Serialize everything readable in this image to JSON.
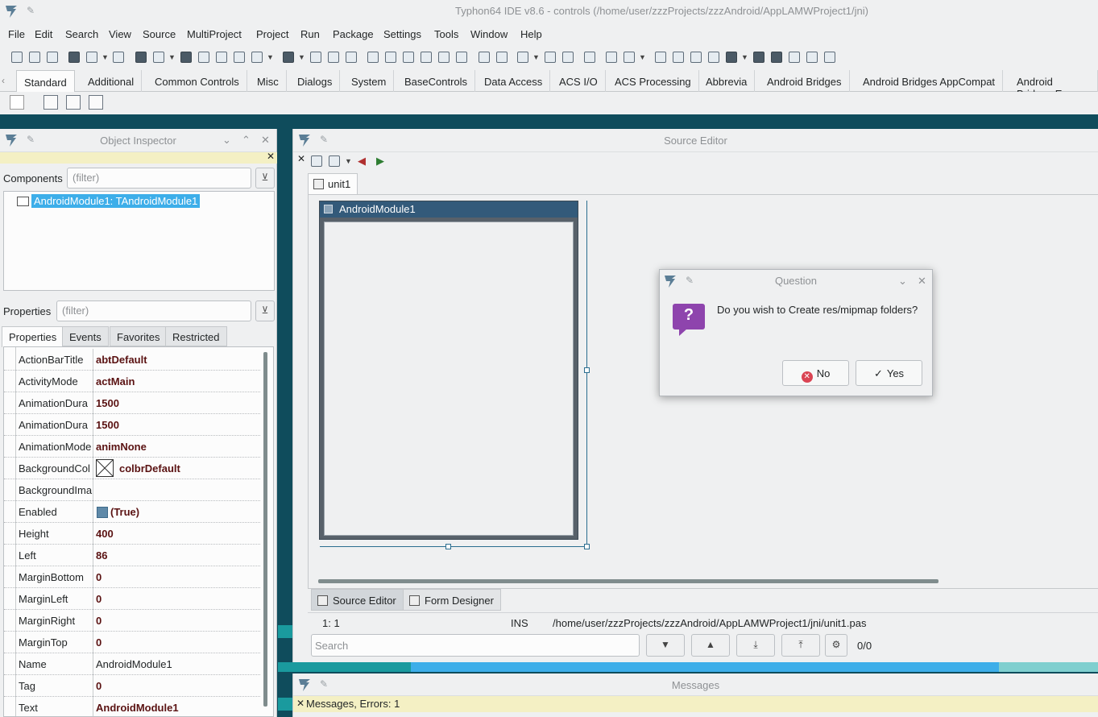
{
  "window": {
    "title": "Typhon64 IDE v8.6 - controls (/home/user/zzzProjects/zzzAndroid/AppLAMWProject1/jni)"
  },
  "menu": [
    "File",
    "Edit",
    "Search",
    "View",
    "Source",
    "MultiProject",
    "Project",
    "Run",
    "Package",
    "Settings",
    "Tools",
    "Window",
    "Help"
  ],
  "palette_tabs": [
    "Standard",
    "Additional",
    "Common Controls",
    "Misc",
    "Dialogs",
    "System",
    "BaseControls",
    "Data Access",
    "ACS I/O",
    "ACS Processing",
    "Abbrevia",
    "Android Bridges",
    "Android Bridges AppCompat",
    "Android Bridges E"
  ],
  "palette_active": "Standard",
  "object_inspector": {
    "title": "Object Inspector",
    "components_label": "Components",
    "components_filter_placeholder": "(filter)",
    "tree_node": "AndroidModule1: TAndroidModule1",
    "properties_label": "Properties",
    "properties_filter_placeholder": "(filter)",
    "tabs": [
      "Properties",
      "Events",
      "Favorites",
      "Restricted"
    ],
    "rows": [
      {
        "name": "ActionBarTitle",
        "value": "abtDefault"
      },
      {
        "name": "ActivityMode",
        "value": "actMain"
      },
      {
        "name": "AnimationDura",
        "value": "1500"
      },
      {
        "name": "AnimationDura",
        "value": "1500"
      },
      {
        "name": "AnimationMode",
        "value": "animNone"
      },
      {
        "name": "BackgroundCol",
        "value": "colbrDefault"
      },
      {
        "name": "BackgroundIma",
        "value": ""
      },
      {
        "name": "Enabled",
        "value": "(True)"
      },
      {
        "name": "Height",
        "value": "400"
      },
      {
        "name": "Left",
        "value": "86"
      },
      {
        "name": "MarginBottom",
        "value": "0"
      },
      {
        "name": "MarginLeft",
        "value": "0"
      },
      {
        "name": "MarginRight",
        "value": "0"
      },
      {
        "name": "MarginTop",
        "value": "0"
      },
      {
        "name": "Name",
        "value": "AndroidModule1"
      },
      {
        "name": "Tag",
        "value": "0"
      },
      {
        "name": "Text",
        "value": "AndroidModule1"
      }
    ]
  },
  "source_editor": {
    "title": "Source Editor",
    "file_tab": "unit1",
    "form_caption": "AndroidModule1",
    "bottom_tabs": [
      "Source Editor",
      "Form Designer"
    ],
    "status_pos": "1:  1",
    "status_mode": "INS",
    "status_path": "/home/user/zzzProjects/zzzAndroid/AppLAMWProject1/jni/unit1.pas",
    "search_placeholder": "Search",
    "search_count": "0/0"
  },
  "messages": {
    "title": "Messages",
    "line": "Messages, Errors: 1"
  },
  "dialog": {
    "title": "Question",
    "message": "Do you wish to Create res/mipmap folders?",
    "no_label": "No",
    "yes_label": "Yes"
  },
  "colors": {
    "accent": "#3daee9",
    "teal_background": "#0f4c5c",
    "question_icon": "#8e44ad",
    "no_icon": "#da4453"
  }
}
